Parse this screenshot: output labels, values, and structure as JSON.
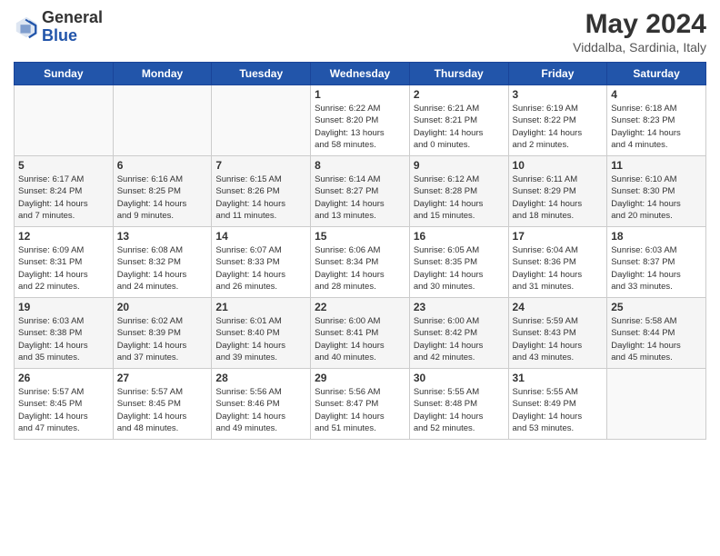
{
  "logo": {
    "general": "General",
    "blue": "Blue"
  },
  "header": {
    "month_year": "May 2024",
    "location": "Viddalba, Sardinia, Italy"
  },
  "weekdays": [
    "Sunday",
    "Monday",
    "Tuesday",
    "Wednesday",
    "Thursday",
    "Friday",
    "Saturday"
  ],
  "weeks": [
    [
      {
        "day": "",
        "info": ""
      },
      {
        "day": "",
        "info": ""
      },
      {
        "day": "",
        "info": ""
      },
      {
        "day": "1",
        "info": "Sunrise: 6:22 AM\nSunset: 8:20 PM\nDaylight: 13 hours\nand 58 minutes."
      },
      {
        "day": "2",
        "info": "Sunrise: 6:21 AM\nSunset: 8:21 PM\nDaylight: 14 hours\nand 0 minutes."
      },
      {
        "day": "3",
        "info": "Sunrise: 6:19 AM\nSunset: 8:22 PM\nDaylight: 14 hours\nand 2 minutes."
      },
      {
        "day": "4",
        "info": "Sunrise: 6:18 AM\nSunset: 8:23 PM\nDaylight: 14 hours\nand 4 minutes."
      }
    ],
    [
      {
        "day": "5",
        "info": "Sunrise: 6:17 AM\nSunset: 8:24 PM\nDaylight: 14 hours\nand 7 minutes."
      },
      {
        "day": "6",
        "info": "Sunrise: 6:16 AM\nSunset: 8:25 PM\nDaylight: 14 hours\nand 9 minutes."
      },
      {
        "day": "7",
        "info": "Sunrise: 6:15 AM\nSunset: 8:26 PM\nDaylight: 14 hours\nand 11 minutes."
      },
      {
        "day": "8",
        "info": "Sunrise: 6:14 AM\nSunset: 8:27 PM\nDaylight: 14 hours\nand 13 minutes."
      },
      {
        "day": "9",
        "info": "Sunrise: 6:12 AM\nSunset: 8:28 PM\nDaylight: 14 hours\nand 15 minutes."
      },
      {
        "day": "10",
        "info": "Sunrise: 6:11 AM\nSunset: 8:29 PM\nDaylight: 14 hours\nand 18 minutes."
      },
      {
        "day": "11",
        "info": "Sunrise: 6:10 AM\nSunset: 8:30 PM\nDaylight: 14 hours\nand 20 minutes."
      }
    ],
    [
      {
        "day": "12",
        "info": "Sunrise: 6:09 AM\nSunset: 8:31 PM\nDaylight: 14 hours\nand 22 minutes."
      },
      {
        "day": "13",
        "info": "Sunrise: 6:08 AM\nSunset: 8:32 PM\nDaylight: 14 hours\nand 24 minutes."
      },
      {
        "day": "14",
        "info": "Sunrise: 6:07 AM\nSunset: 8:33 PM\nDaylight: 14 hours\nand 26 minutes."
      },
      {
        "day": "15",
        "info": "Sunrise: 6:06 AM\nSunset: 8:34 PM\nDaylight: 14 hours\nand 28 minutes."
      },
      {
        "day": "16",
        "info": "Sunrise: 6:05 AM\nSunset: 8:35 PM\nDaylight: 14 hours\nand 30 minutes."
      },
      {
        "day": "17",
        "info": "Sunrise: 6:04 AM\nSunset: 8:36 PM\nDaylight: 14 hours\nand 31 minutes."
      },
      {
        "day": "18",
        "info": "Sunrise: 6:03 AM\nSunset: 8:37 PM\nDaylight: 14 hours\nand 33 minutes."
      }
    ],
    [
      {
        "day": "19",
        "info": "Sunrise: 6:03 AM\nSunset: 8:38 PM\nDaylight: 14 hours\nand 35 minutes."
      },
      {
        "day": "20",
        "info": "Sunrise: 6:02 AM\nSunset: 8:39 PM\nDaylight: 14 hours\nand 37 minutes."
      },
      {
        "day": "21",
        "info": "Sunrise: 6:01 AM\nSunset: 8:40 PM\nDaylight: 14 hours\nand 39 minutes."
      },
      {
        "day": "22",
        "info": "Sunrise: 6:00 AM\nSunset: 8:41 PM\nDaylight: 14 hours\nand 40 minutes."
      },
      {
        "day": "23",
        "info": "Sunrise: 6:00 AM\nSunset: 8:42 PM\nDaylight: 14 hours\nand 42 minutes."
      },
      {
        "day": "24",
        "info": "Sunrise: 5:59 AM\nSunset: 8:43 PM\nDaylight: 14 hours\nand 43 minutes."
      },
      {
        "day": "25",
        "info": "Sunrise: 5:58 AM\nSunset: 8:44 PM\nDaylight: 14 hours\nand 45 minutes."
      }
    ],
    [
      {
        "day": "26",
        "info": "Sunrise: 5:57 AM\nSunset: 8:45 PM\nDaylight: 14 hours\nand 47 minutes."
      },
      {
        "day": "27",
        "info": "Sunrise: 5:57 AM\nSunset: 8:45 PM\nDaylight: 14 hours\nand 48 minutes."
      },
      {
        "day": "28",
        "info": "Sunrise: 5:56 AM\nSunset: 8:46 PM\nDaylight: 14 hours\nand 49 minutes."
      },
      {
        "day": "29",
        "info": "Sunrise: 5:56 AM\nSunset: 8:47 PM\nDaylight: 14 hours\nand 51 minutes."
      },
      {
        "day": "30",
        "info": "Sunrise: 5:55 AM\nSunset: 8:48 PM\nDaylight: 14 hours\nand 52 minutes."
      },
      {
        "day": "31",
        "info": "Sunrise: 5:55 AM\nSunset: 8:49 PM\nDaylight: 14 hours\nand 53 minutes."
      },
      {
        "day": "",
        "info": ""
      }
    ]
  ]
}
